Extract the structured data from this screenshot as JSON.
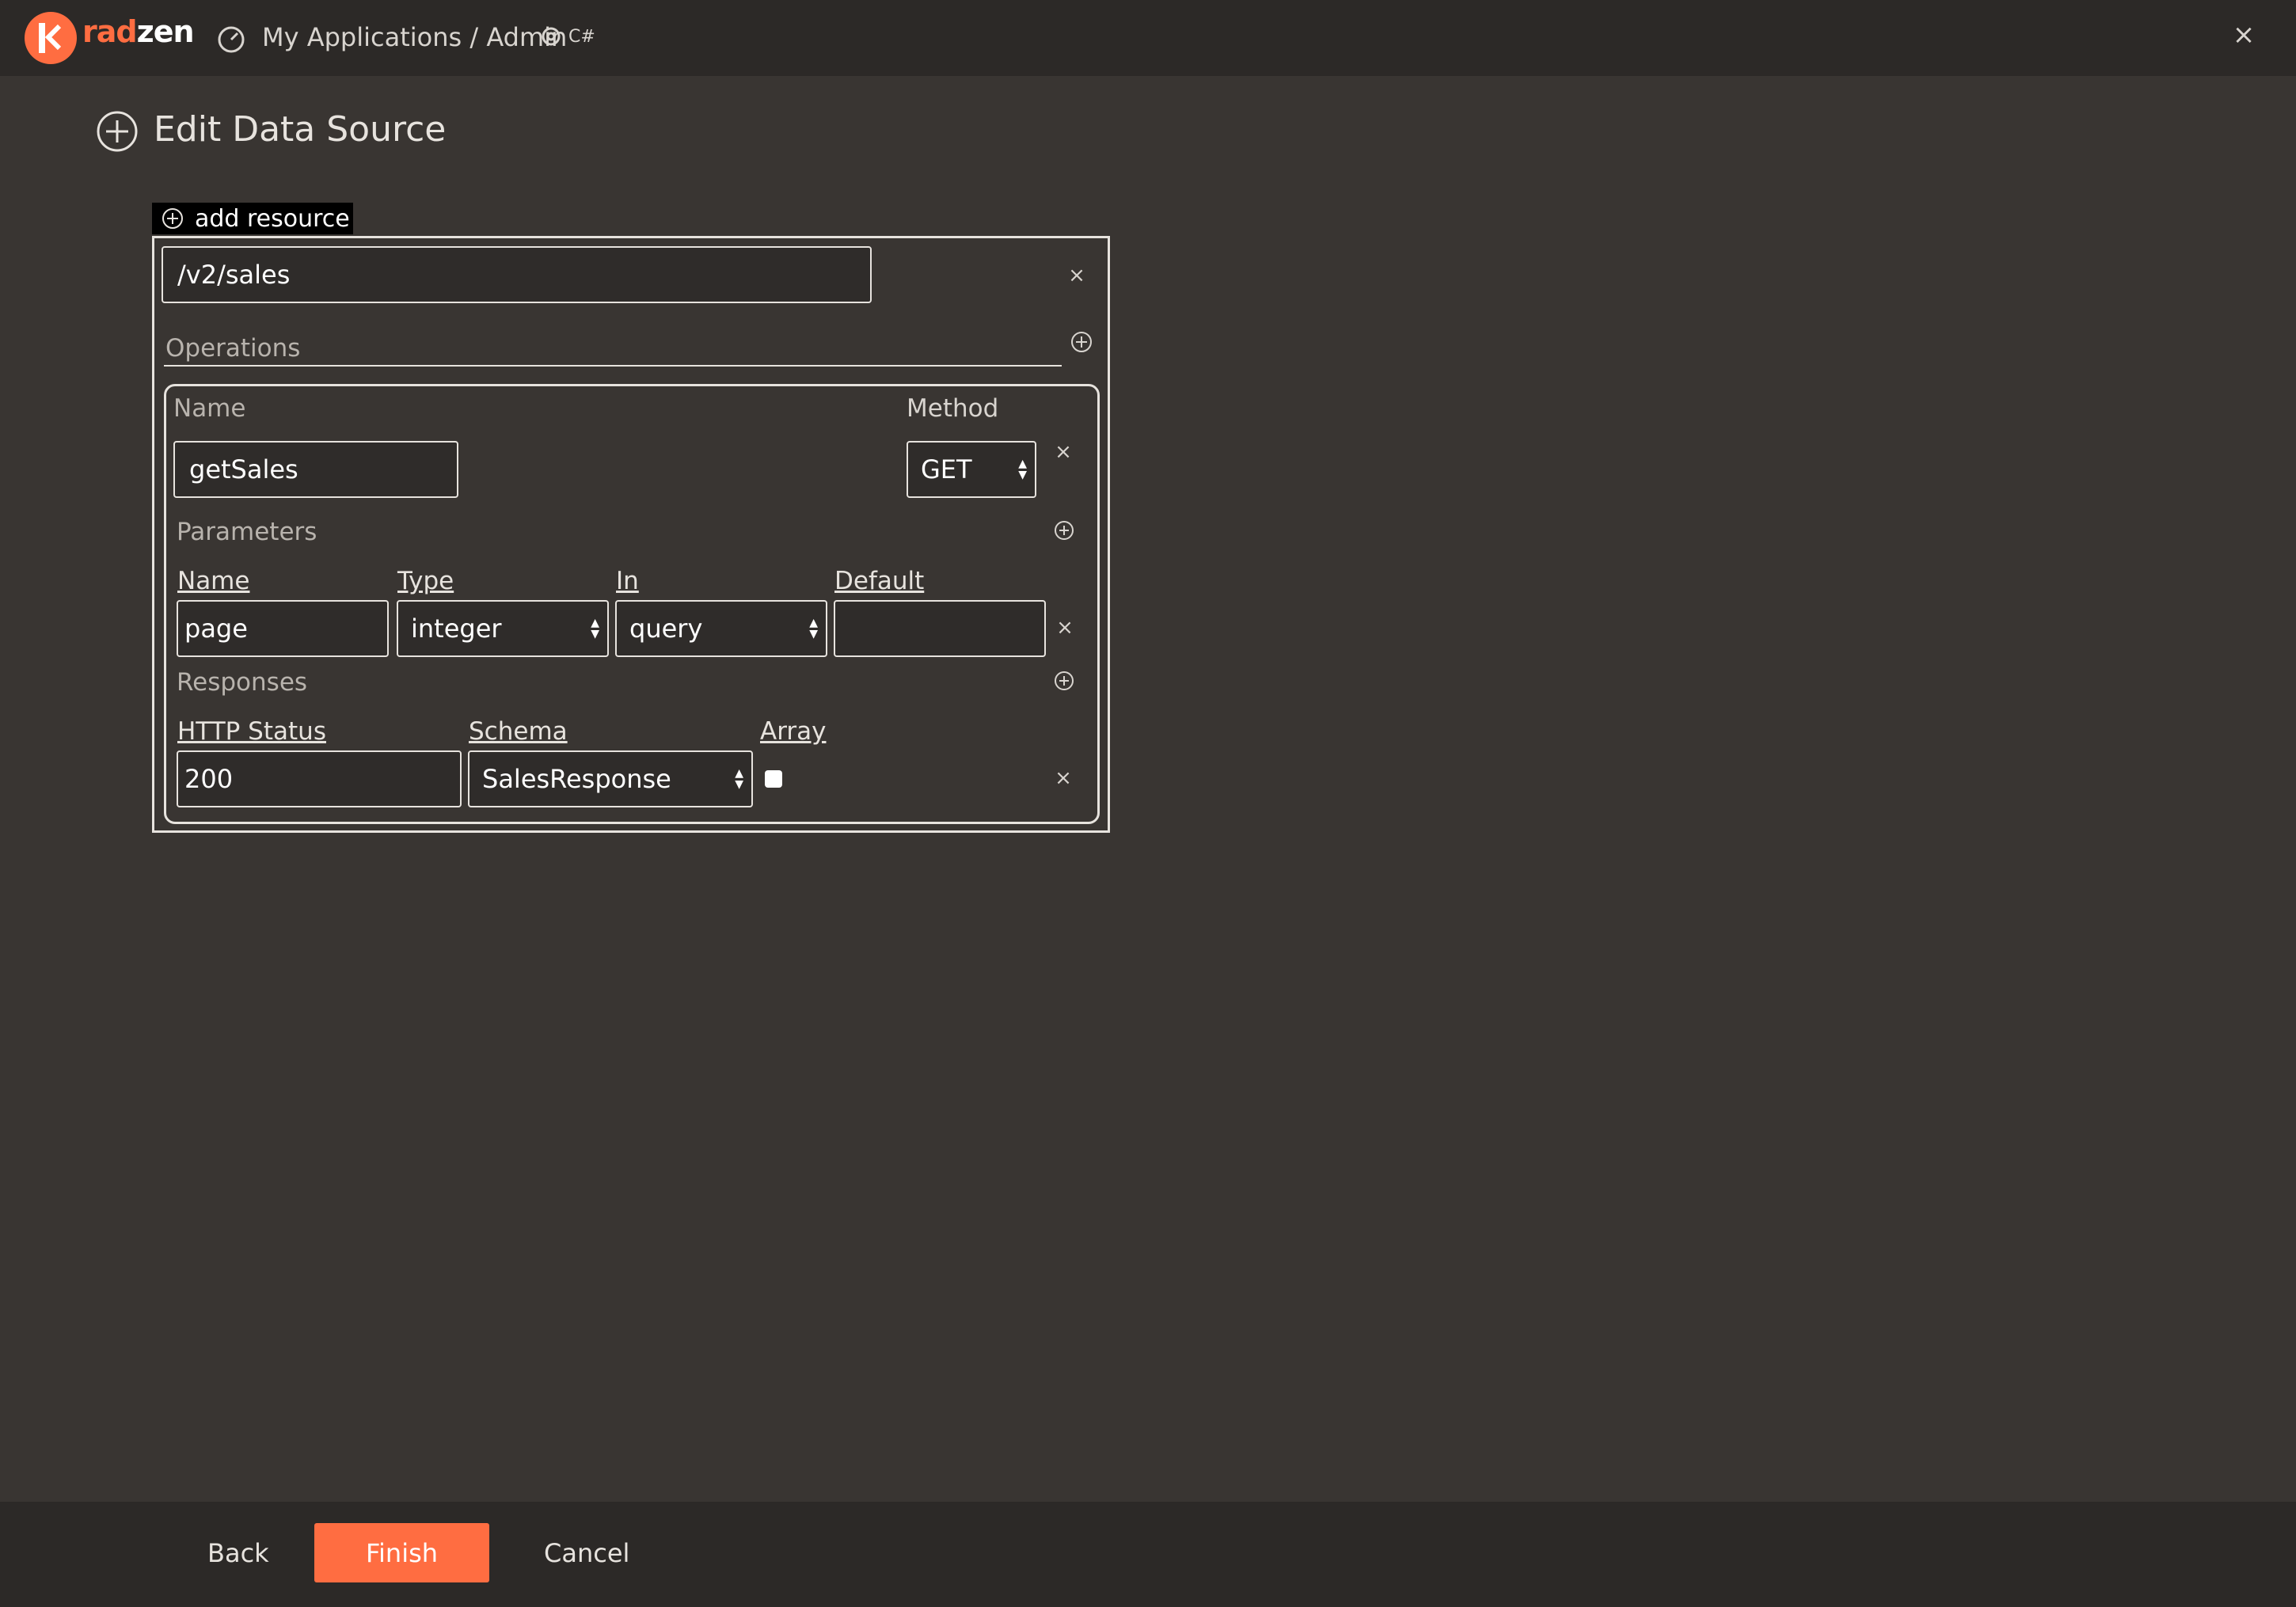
{
  "app": {
    "logo_prefix": "rad",
    "logo_suffix": "zen",
    "breadcrumb": "My Applications / Admin",
    "framework_badge": "C#",
    "close_glyph": "×"
  },
  "page": {
    "title": "Edit Data Source",
    "add_resource_label": "add resource"
  },
  "resource": {
    "path_value": "/v2/sales",
    "operations_label": "Operations",
    "operation": {
      "name_label": "Name",
      "name_value": "getSales",
      "method_label": "Method",
      "method_value": "GET",
      "parameters_label": "Parameters",
      "param_headers": {
        "name": "Name",
        "type": "Type",
        "in": "In",
        "default": "Default"
      },
      "parameter": {
        "name": "page",
        "type": "integer",
        "in": "query",
        "default": ""
      },
      "responses_label": "Responses",
      "response_headers": {
        "status": "HTTP Status",
        "schema": "Schema",
        "array": "Array"
      },
      "response": {
        "status": "200",
        "schema": "SalesResponse",
        "array": false
      }
    }
  },
  "footer": {
    "back_label": "Back",
    "finish_label": "Finish",
    "cancel_label": "Cancel"
  },
  "colors": {
    "accent": "#ff6d41",
    "background": "#393532",
    "bar": "#2c2927"
  }
}
